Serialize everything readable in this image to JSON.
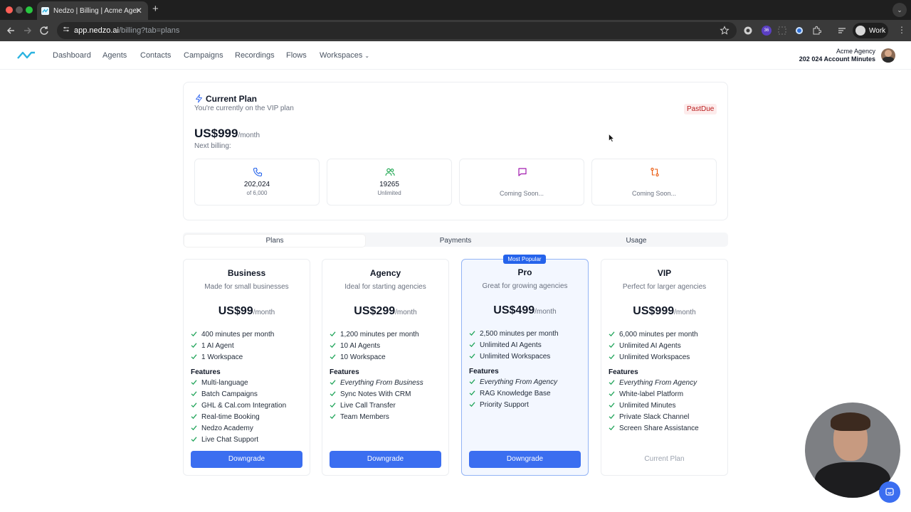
{
  "browser": {
    "tab_title": "Nedzo | Billing | Acme Agency",
    "url_host": "app.nedzo.ai",
    "url_path": "/billing?tab=plans",
    "ext_badge": "36",
    "profile_label": "Work"
  },
  "nav": {
    "items": [
      "Dashboard",
      "Agents",
      "Contacts",
      "Campaigns",
      "Recordings",
      "Flows",
      "Workspaces"
    ],
    "account_name": "Acme Agency",
    "account_minutes": "202 024 Account Minutes"
  },
  "current_plan": {
    "title": "Current Plan",
    "subtitle": "You're currently on the VIP plan",
    "status": "PastDue",
    "price": "US$999",
    "per": "/month",
    "next_billing": "Next billing:",
    "stats": [
      {
        "value": "202,024",
        "label": "of 6,000"
      },
      {
        "value": "19265",
        "label": "Unlimited"
      },
      {
        "value": "",
        "label": "Coming Soon..."
      },
      {
        "value": "",
        "label": "Coming Soon..."
      }
    ]
  },
  "tabs": [
    "Plans",
    "Payments",
    "Usage"
  ],
  "active_tab": "Plans",
  "popular_badge": "Most Popular",
  "features_heading": "Features",
  "plans": [
    {
      "name": "Business",
      "desc": "Made for small businesses",
      "price": "US$99",
      "per": "/month",
      "limits": [
        "400 minutes per month",
        "1 AI Agent",
        "1 Workspace"
      ],
      "features": [
        "Multi-language",
        "Batch Campaigns",
        "GHL & Cal.com Integration",
        "Real-time Booking",
        "Nedzo Academy",
        "Live Chat Support"
      ],
      "action": "Downgrade"
    },
    {
      "name": "Agency",
      "desc": "Ideal for starting agencies",
      "price": "US$299",
      "per": "/month",
      "limits": [
        "1,200 minutes per month",
        "10 AI Agents",
        "10 Workspace"
      ],
      "features": [
        "Everything From Business",
        "Sync Notes With CRM",
        "Live Call Transfer",
        "Team Members"
      ],
      "action": "Downgrade"
    },
    {
      "name": "Pro",
      "desc": "Great for growing agencies",
      "price": "US$499",
      "per": "/month",
      "limits": [
        "2,500 minutes per month",
        "Unlimited AI Agents",
        "Unlimited Workspaces"
      ],
      "features": [
        "Everything From Agency",
        "RAG Knowledge Base",
        "Priority Support"
      ],
      "action": "Downgrade"
    },
    {
      "name": "VIP",
      "desc": "Perfect for larger agencies",
      "price": "US$999",
      "per": "/month",
      "limits": [
        "6,000 minutes per month",
        "Unlimited AI Agents",
        "Unlimited Workspaces"
      ],
      "features": [
        "Everything From Agency",
        "White-label Platform",
        "Unlimited Minutes",
        "Private Slack Channel",
        "Screen Share Assistance"
      ],
      "action": "Current Plan"
    }
  ],
  "colors": {
    "accent": "#3b6ef0",
    "check": "#22a55b",
    "past_due": "#b91c1c"
  }
}
